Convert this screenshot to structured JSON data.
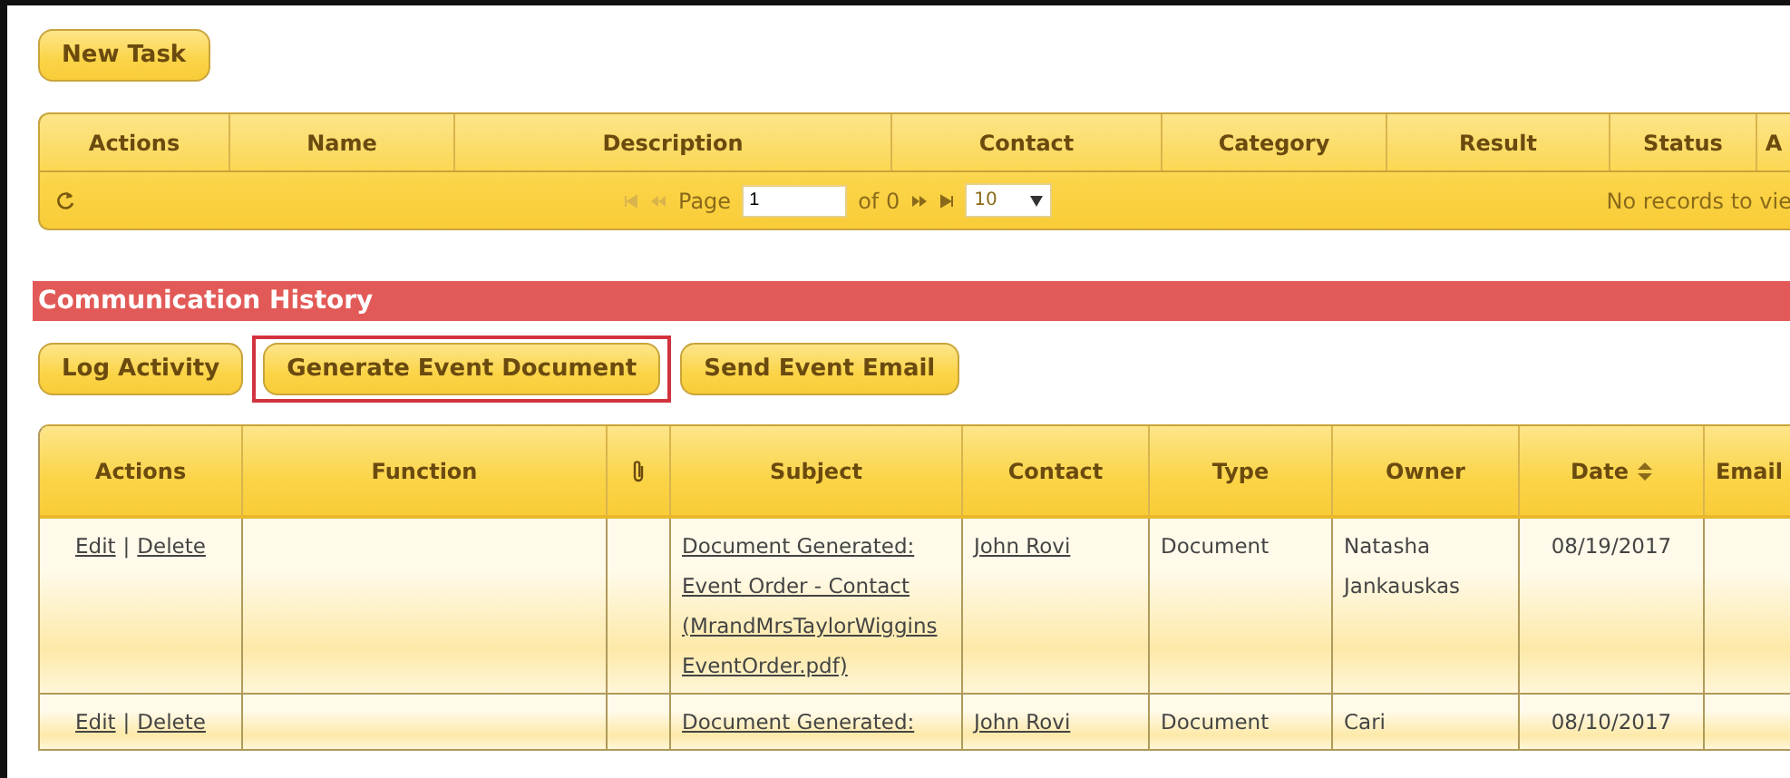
{
  "new_task_button": "New Task",
  "task_table": {
    "columns": [
      "Actions",
      "Name",
      "Description",
      "Contact",
      "Category",
      "Result",
      "Status",
      "A"
    ],
    "pager": {
      "page_label": "Page",
      "page_value": "1",
      "of_label": "of 0",
      "page_size": "10",
      "status": "No records to vie"
    }
  },
  "section_title": "Communication History",
  "buttons": [
    {
      "label": "Log Activity",
      "highlighted": false
    },
    {
      "label": "Generate Event Document",
      "highlighted": true
    },
    {
      "label": "Send Event Email",
      "highlighted": false
    }
  ],
  "history_table": {
    "columns": [
      {
        "kind": "text",
        "label": "Actions"
      },
      {
        "kind": "text",
        "label": "Function"
      },
      {
        "kind": "attachment"
      },
      {
        "kind": "text",
        "label": "Subject"
      },
      {
        "kind": "text",
        "label": "Contact"
      },
      {
        "kind": "text",
        "label": "Type"
      },
      {
        "kind": "text",
        "label": "Owner"
      },
      {
        "kind": "sort",
        "label": "Date"
      },
      {
        "kind": "text",
        "label": "Email"
      }
    ],
    "rows": [
      {
        "edit": "Edit",
        "separator": "|",
        "delete": "Delete",
        "subject": "Document Generated: Event Order - Contact (MrandMrsTaylorWiggins EventOrder.pdf)",
        "contact": "John Rovi",
        "type": "Document",
        "owner": "Natasha Jankauskas",
        "date": "08/19/2017"
      },
      {
        "edit": "Edit",
        "separator": "|",
        "delete": "Delete",
        "subject": "Document Generated:",
        "contact": "John Rovi",
        "type": "Document",
        "owner": "Cari",
        "date": "08/10/2017"
      }
    ]
  }
}
